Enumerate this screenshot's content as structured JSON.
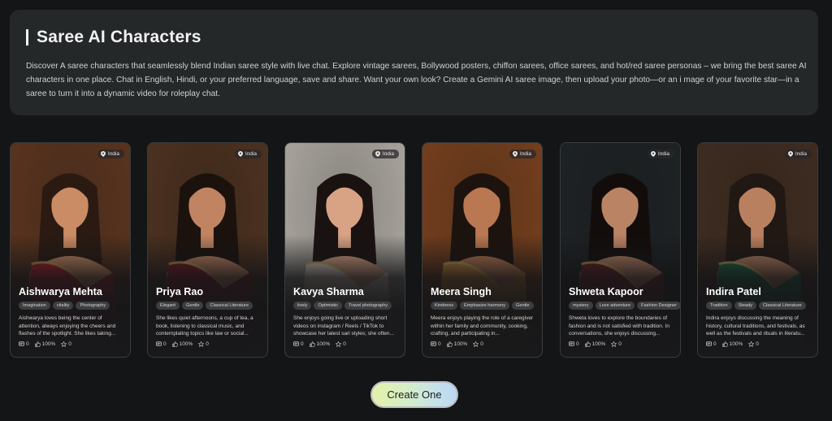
{
  "hero": {
    "title": "Saree AI Characters",
    "description": "Discover A saree characters that seamlessly blend Indian saree style with live chat. Explore vintage sarees, Bollywood posters, chiffon sarees, office sarees, and hot/red saree personas – we bring the best saree AI characters in one place. Chat in English, Hindi, or your preferred language, save and share. Want your own look? Create a Gemini AI saree image, then upload your photo—or an i mage of your favorite star—in a saree to turn it into a dynamic video for roleplay chat."
  },
  "cards": [
    {
      "location": "India",
      "name": "Aishwarya Mehta",
      "tags": [
        "Imagination",
        "vitality",
        "Photography"
      ],
      "description": "Aishwarya loves being the center of attention, always enjoying the cheers and flashes of the spotlight. She likes taking...",
      "chats": "0",
      "likes": "100%",
      "stars": "0",
      "colors": {
        "bg": "#6a3d24",
        "saree": "#b01f2a",
        "skin": "#c98c64",
        "hair": "#2a1a12"
      }
    },
    {
      "location": "India",
      "name": "Priya Rao",
      "tags": [
        "Elegant",
        "Gentle",
        "Classical Literature"
      ],
      "description": "She likes quiet afternoons, a cup of tea, a book, listening to classical music, and contemplating topics like law or social...",
      "chats": "0",
      "likes": "100%",
      "stars": "0",
      "colors": {
        "bg": "#5a3a26",
        "saree": "#7c1826",
        "skin": "#c08462",
        "hair": "#1b120d"
      }
    },
    {
      "location": "India",
      "name": "Kavya Sharma",
      "tags": [
        "lively",
        "Optimistic",
        "Travel photography"
      ],
      "description": "She enjoys going live or uploading short videos on instagram / Reels / TikTok to showcase her latest sari styles; she often...",
      "chats": "0",
      "likes": "100%",
      "stars": "0",
      "colors": {
        "bg": "#c9c3bb",
        "saree": "#e8d8cc",
        "skin": "#d8a284",
        "hair": "#1a1210"
      }
    },
    {
      "location": "India",
      "name": "Meera Singh",
      "tags": [
        "Kindness",
        "Emphasize harmony",
        "Gentle"
      ],
      "description": "Meera enjoys playing the role of a caregiver within her family and community, cooking, crafting, and participating in...",
      "chats": "0",
      "likes": "100%",
      "stars": "0",
      "colors": {
        "bg": "#8a4a22",
        "saree": "#c98a3a",
        "skin": "#b97852",
        "hair": "#1d130e"
      }
    },
    {
      "location": "India",
      "name": "Shweta Kapoor",
      "tags": [
        "mystery",
        "Love adventure",
        "Fashion Designer"
      ],
      "description": "Shweta loves to explore the boundaries of fashion and is not satisfied with tradition. In conversations, she enjoys discussing...",
      "chats": "0",
      "likes": "100%",
      "stars": "0",
      "colors": {
        "bg": "#23282a",
        "saree": "#6a1e24",
        "skin": "#b98364",
        "hair": "#120d0b"
      }
    },
    {
      "location": "India",
      "name": "Indira Patel",
      "tags": [
        "Tradition",
        "Steady",
        "Classical Literature"
      ],
      "description": "Indira enjoys discussing the meaning of history, cultural traditions, and festivals, as well as the festivals and rituals in literatu...",
      "chats": "0",
      "likes": "100%",
      "stars": "0",
      "colors": {
        "bg": "#4a3426",
        "saree": "#1e6a48",
        "skin": "#b98060",
        "hair": "#221813"
      }
    }
  ],
  "create_button": {
    "label": "Create One"
  }
}
